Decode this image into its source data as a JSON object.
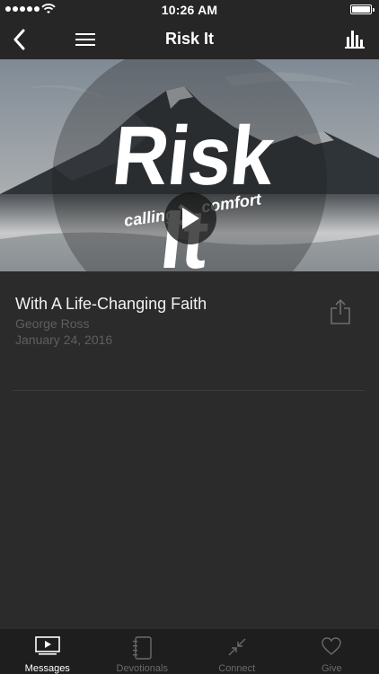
{
  "status_bar": {
    "time": "10:26 AM"
  },
  "nav": {
    "title": "Risk It"
  },
  "hero": {
    "series_title": "Risk It",
    "tagline_left": "calling",
    "tagline_right": "comfort"
  },
  "message": {
    "title": "With A Life-Changing Faith",
    "speaker": "George Ross",
    "date": "January 24, 2016"
  },
  "tabs": [
    {
      "label": "Messages",
      "icon": "play-screen-icon",
      "active": true
    },
    {
      "label": "Devotionals",
      "icon": "notebook-icon",
      "active": false
    },
    {
      "label": "Connect",
      "icon": "arrows-in-icon",
      "active": false
    },
    {
      "label": "Give",
      "icon": "heart-icon",
      "active": false
    }
  ]
}
